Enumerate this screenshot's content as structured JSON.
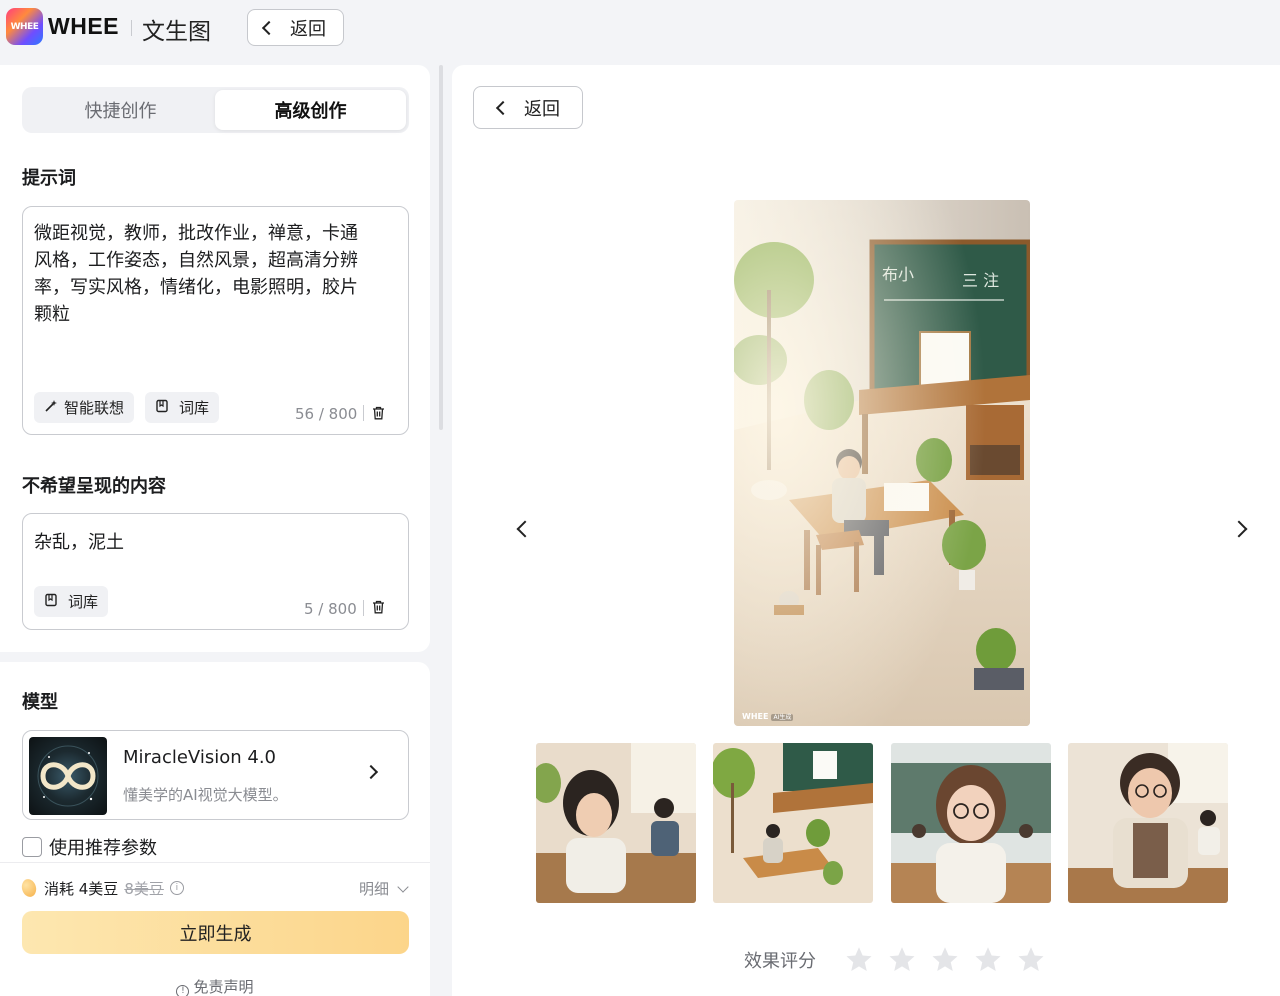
{
  "header": {
    "logo_text": "WHEE",
    "brand": "WHEE",
    "page_name": "文生图",
    "back_label": "返回"
  },
  "tabs": [
    {
      "label": "快捷创作",
      "active": false
    },
    {
      "label": "高级创作",
      "active": true
    }
  ],
  "prompt": {
    "title": "提示词",
    "value": "微距视觉，教师，批改作业，禅意，卡通风格，工作姿态，自然风景，超高清分辨率，写实风格，情绪化，电影照明，胶片颗粒",
    "smart_label": "智能联想",
    "library_label": "词库",
    "counter": "56 / 800"
  },
  "negative": {
    "title": "不希望呈现的内容",
    "value": "杂乱，泥土",
    "library_label": "词库",
    "counter": "5 / 800"
  },
  "model": {
    "title": "模型",
    "name": "MiracleVision 4.0",
    "desc": "懂美学的AI视觉大模型。",
    "use_recommended_label": "使用推荐参数",
    "use_recommended_checked": false
  },
  "footer": {
    "cost_label": "消耗 4美豆",
    "original_cost": "8美豆",
    "detail_label": "明细",
    "generate_label": "立即生成",
    "disclaimer": "免责声明"
  },
  "preview": {
    "back_label": "返回",
    "watermark": "WHEE",
    "watermark_tag": "AI生成",
    "thumbnails": [
      "student-reading",
      "teacher-at-desk",
      "teacher-glasses",
      "teacher-writing"
    ],
    "selected_thumbnail": 1,
    "rating_label": "效果评分",
    "rating_value": 0,
    "rating_max": 5
  },
  "colors": {
    "generate_gradient_start": "#fde7b0",
    "generate_gradient_end": "#fcd58a",
    "star_empty": "#e4e5e8"
  }
}
